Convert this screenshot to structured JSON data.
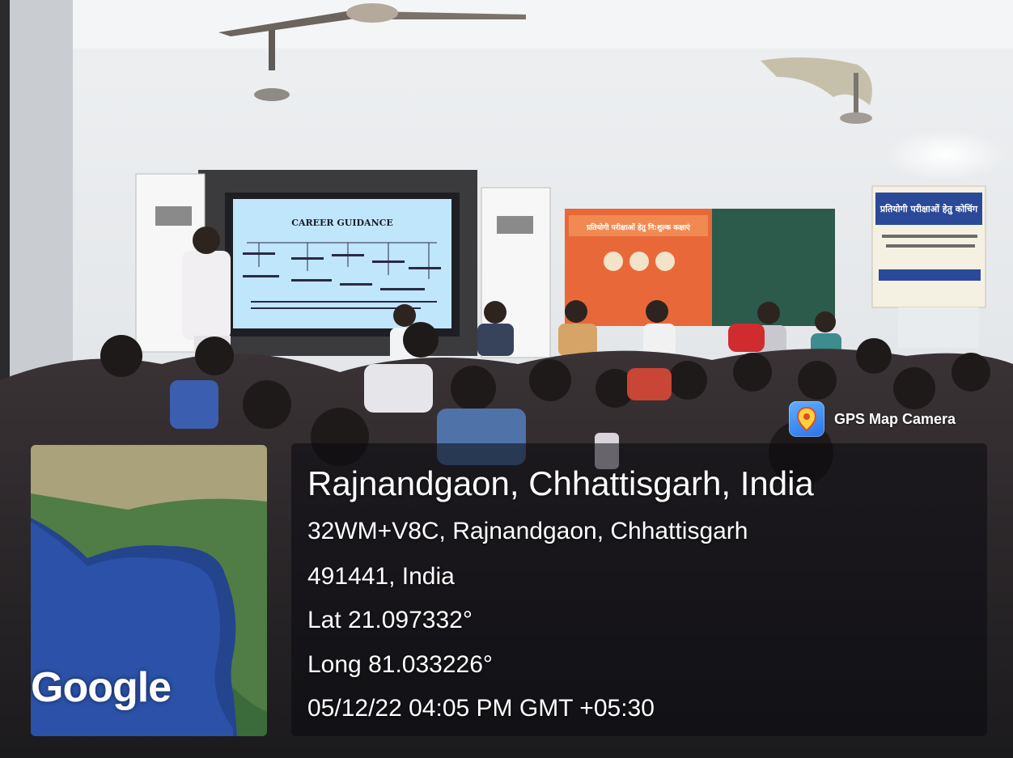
{
  "photo": {
    "description": "classroom-seminar-photo",
    "slide_title": "CAREER GUIDANCE",
    "banner_center_text": "प्रतियोगी परीक्षाओं हेतु नि:शुल्क कक्षाएं",
    "banner_right_text": "प्रतियोगी परीक्षाओं हेतु कोचिंग"
  },
  "stamp": {
    "app_name": "GPS Map Camera",
    "map_logo": "Google",
    "place": "Rajnandgaon, Chhattisgarh, India",
    "address_line1": "32WM+V8C, Rajnandgaon, Chhattisgarh",
    "address_line2": "491441, India",
    "lat": "Lat 21.097332°",
    "long": "Long 81.033226°",
    "datetime": "05/12/22 04:05 PM GMT +05:30"
  },
  "icons": {
    "app_icon": "map-pin-icon"
  }
}
